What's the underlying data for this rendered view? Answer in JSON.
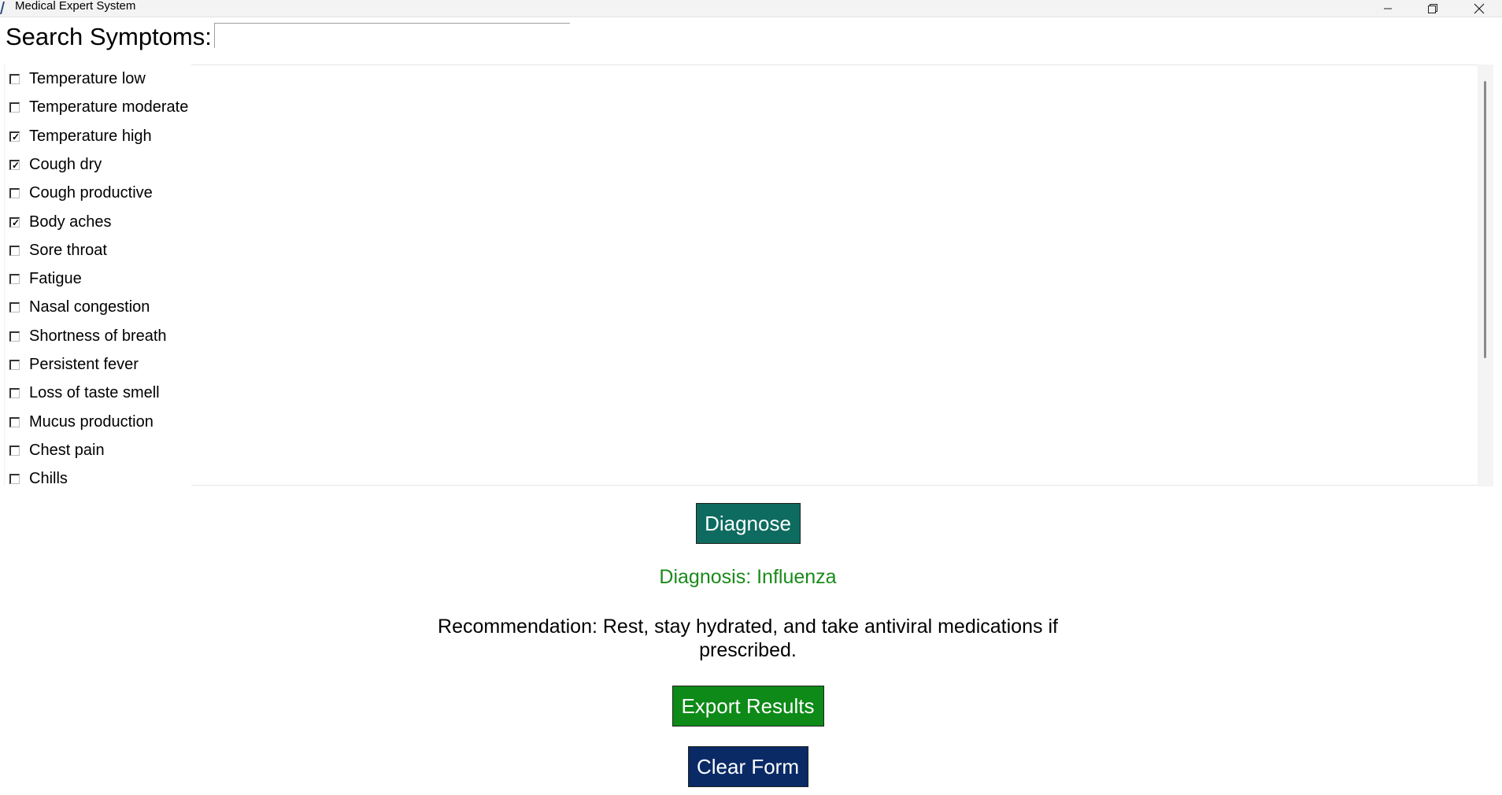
{
  "window": {
    "title": "Medical Expert System",
    "controls": [
      "minimize",
      "restore",
      "close"
    ]
  },
  "search": {
    "label": "Search Symptoms:",
    "value": "",
    "placeholder": ""
  },
  "symptoms": [
    {
      "label": "Temperature low",
      "checked": false
    },
    {
      "label": "Temperature moderate",
      "checked": false
    },
    {
      "label": "Temperature high",
      "checked": true
    },
    {
      "label": "Cough dry",
      "checked": true
    },
    {
      "label": "Cough productive",
      "checked": false
    },
    {
      "label": "Body aches",
      "checked": true
    },
    {
      "label": "Sore throat",
      "checked": false
    },
    {
      "label": "Fatigue",
      "checked": false
    },
    {
      "label": "Nasal congestion",
      "checked": false
    },
    {
      "label": "Shortness of breath",
      "checked": false
    },
    {
      "label": "Persistent fever",
      "checked": false
    },
    {
      "label": "Loss of taste smell",
      "checked": false
    },
    {
      "label": "Mucus production",
      "checked": false
    },
    {
      "label": "Chest pain",
      "checked": false
    },
    {
      "label": "Chills",
      "checked": false
    }
  ],
  "actions": {
    "diagnose_label": "Diagnose",
    "export_label": "Export Results",
    "clear_label": "Clear Form"
  },
  "result": {
    "diagnosis": "Diagnosis: Influenza",
    "recommendation_line1": "Recommendation: Rest, stay hydrated, and take antiviral medications if",
    "recommendation_line2": "prescribed."
  },
  "colors": {
    "diagnose_button": "#0d6b5f",
    "export_button": "#0d8a17",
    "clear_button": "#0a2a66",
    "diagnosis_text": "#1a8a1a"
  },
  "icons": {
    "minimize": "minimize-icon",
    "restore": "restore-icon",
    "close": "close-icon",
    "app": "app-icon"
  }
}
